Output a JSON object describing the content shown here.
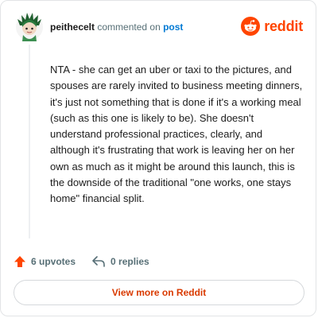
{
  "comment": {
    "username": "peithecelt",
    "action_text": "commented on",
    "post_link": "post",
    "body": "NTA - she can get an uber or taxi to the pictures, and spouses are rarely invited to business meeting dinners, it's just not something that is done if it's a working meal (such as this one is likely to be). She doesn't understand professional practices, clearly, and although it's frustrating that work is leaving her on her own as much as it might be around this launch, this is the downside of the traditional \"one works, one stays home\" financial split."
  },
  "brand": {
    "wordmark": "reddit",
    "color": "#ff4500"
  },
  "actions": {
    "upvotes": "6 upvotes",
    "replies": "0 replies"
  },
  "footer": {
    "button_label": "View more on Reddit"
  },
  "colors": {
    "upvote": "#ff4500",
    "link": "#0079d3",
    "button_text": "#d93a00"
  }
}
